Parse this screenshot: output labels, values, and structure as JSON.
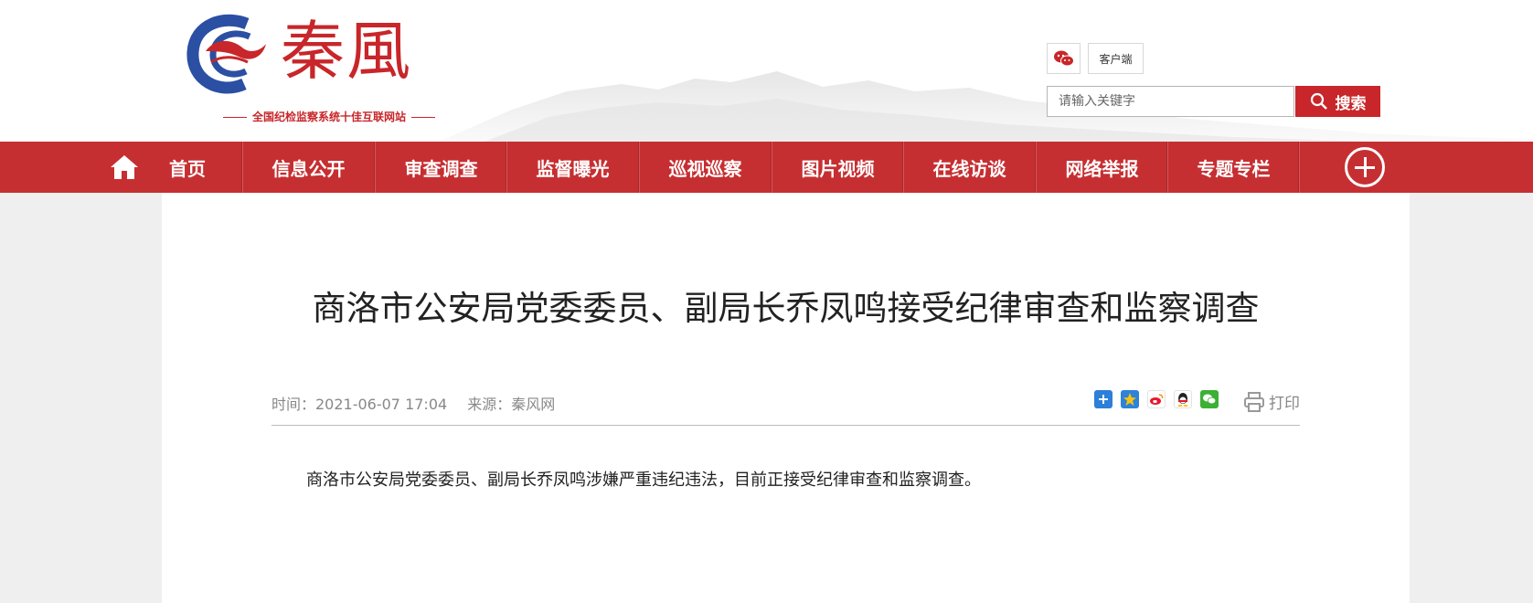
{
  "site": {
    "logo_title": "秦風",
    "logo_subtitle": "全国纪检监察系统十佳互联网站"
  },
  "header": {
    "wechat_icon": "wechat-icon",
    "client_label": "客户端",
    "search_placeholder": "请输入关键字",
    "search_label": "搜索"
  },
  "nav": {
    "items": [
      {
        "label": "首页"
      },
      {
        "label": "信息公开"
      },
      {
        "label": "审查调查"
      },
      {
        "label": "监督曝光"
      },
      {
        "label": "巡视巡察"
      },
      {
        "label": "图片视频"
      },
      {
        "label": "在线访谈"
      },
      {
        "label": "网络举报"
      },
      {
        "label": "专题专栏"
      }
    ],
    "more_icon": "plus-circle-icon"
  },
  "article": {
    "title": "商洛市公安局党委委员、副局长乔凤鸣接受纪律审查和监察调查",
    "time": "时间：2021-06-07 17:04",
    "source": "来源：秦风网",
    "print_label": "打印",
    "share_icons": [
      "share-plus-icon",
      "qzone-icon",
      "weibo-icon",
      "qq-icon",
      "wechat-icon"
    ],
    "body": "商洛市公安局党委委员、副局长乔凤鸣涉嫌严重违纪违法，目前正接受纪律审查和监察调查。"
  },
  "colors": {
    "brand_red": "#c62f32",
    "page_bg": "#efefef"
  }
}
